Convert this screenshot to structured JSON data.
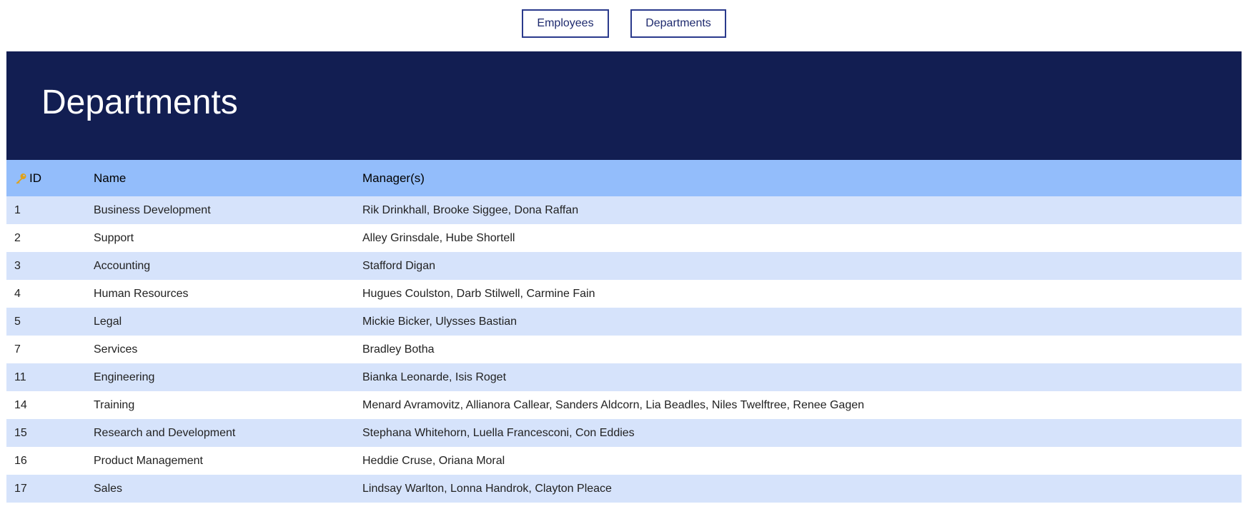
{
  "nav": {
    "employees_label": "Employees",
    "departments_label": "Departments"
  },
  "banner": {
    "title": "Departments"
  },
  "table": {
    "columns": {
      "id": "ID",
      "name": "Name",
      "managers": "Manager(s)"
    },
    "key_icon": "key-icon",
    "key_color": "#e0a21b",
    "rows": [
      {
        "id": "1",
        "name": "Business Development",
        "managers": "Rik Drinkhall, Brooke Siggee, Dona Raffan"
      },
      {
        "id": "2",
        "name": "Support",
        "managers": "Alley Grinsdale, Hube Shortell"
      },
      {
        "id": "3",
        "name": "Accounting",
        "managers": "Stafford Digan"
      },
      {
        "id": "4",
        "name": "Human Resources",
        "managers": "Hugues Coulston, Darb Stilwell, Carmine Fain"
      },
      {
        "id": "5",
        "name": "Legal",
        "managers": "Mickie Bicker, Ulysses Bastian"
      },
      {
        "id": "7",
        "name": "Services",
        "managers": "Bradley Botha"
      },
      {
        "id": "11",
        "name": "Engineering",
        "managers": "Bianka Leonarde, Isis Roget"
      },
      {
        "id": "14",
        "name": "Training",
        "managers": "Menard Avramovitz, Allianora Callear, Sanders Aldcorn, Lia Beadles, Niles Twelftree, Renee Gagen"
      },
      {
        "id": "15",
        "name": "Research and Development",
        "managers": "Stephana Whitehorn, Luella Francesconi, Con Eddies"
      },
      {
        "id": "16",
        "name": "Product Management",
        "managers": "Heddie Cruse, Oriana Moral"
      },
      {
        "id": "17",
        "name": "Sales",
        "managers": "Lindsay Warlton, Lonna Handrok, Clayton Pleace"
      }
    ]
  },
  "colors": {
    "banner_bg": "#121e52",
    "header_bg": "#93bdfb",
    "row_alt_bg": "#d6e3fb",
    "button_border": "#2a3a8c"
  }
}
